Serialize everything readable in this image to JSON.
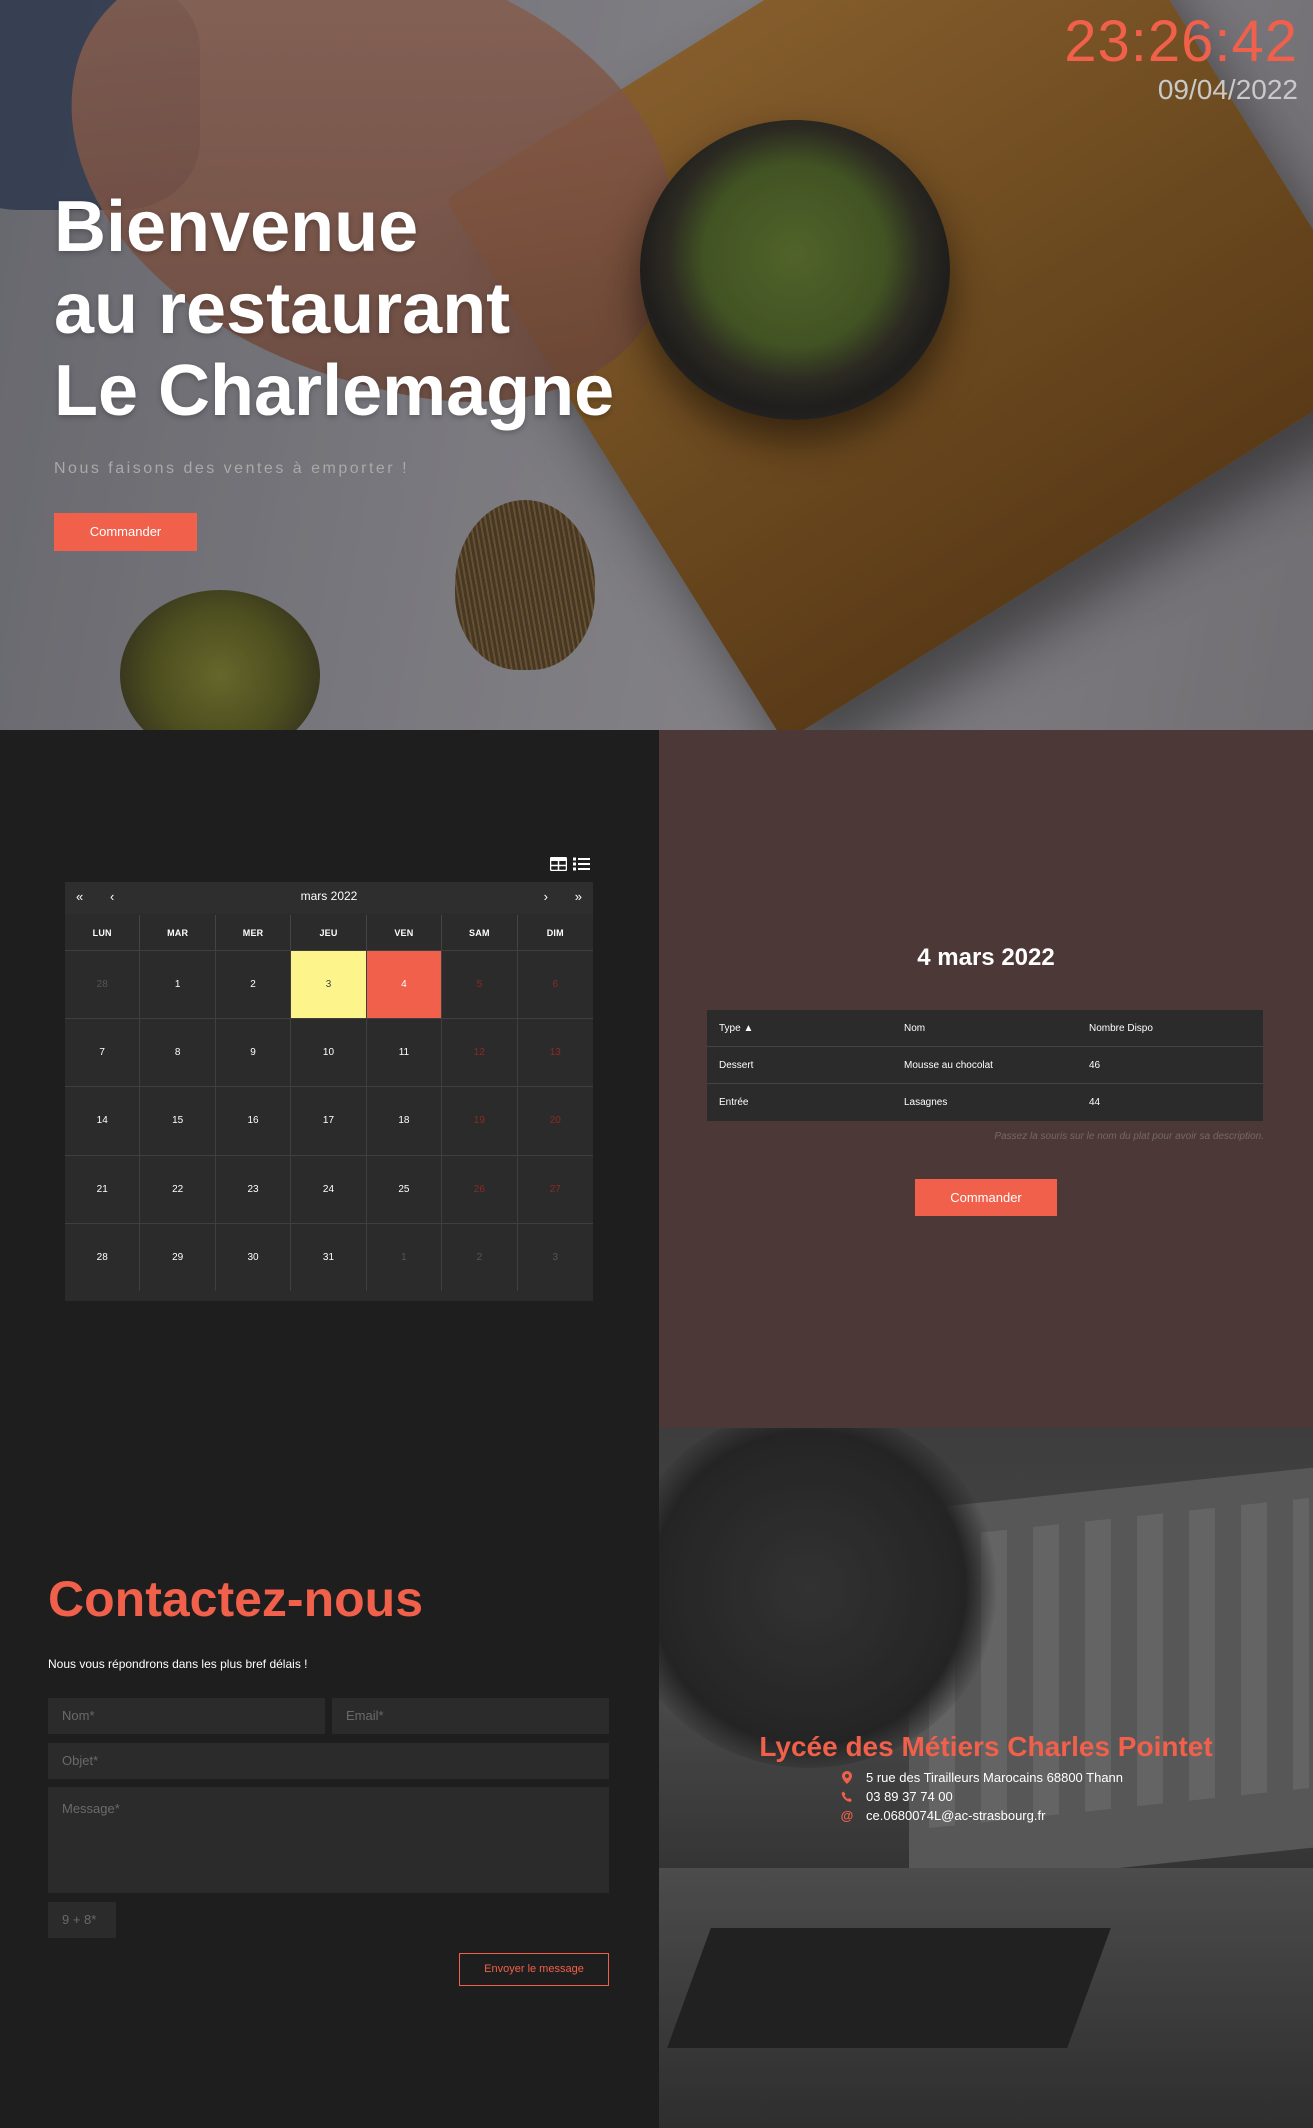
{
  "hero": {
    "clock_time": "23:26:42",
    "clock_date": "09/04/2022",
    "title_lines": [
      "Bienvenue",
      "au restaurant",
      "Le Charlemagne"
    ],
    "subtitle": "Nous faisons des ventes à emporter !",
    "button": "Commander"
  },
  "calendar": {
    "month": "mars 2022",
    "nav": {
      "first": "«",
      "prev": "‹",
      "next": "›",
      "last": "»"
    },
    "weekdays": [
      "LUN",
      "MAR",
      "MER",
      "JEU",
      "VEN",
      "SAM",
      "DIM"
    ],
    "weeks": [
      [
        "28",
        "1",
        "2",
        "3",
        "4",
        "5",
        "6"
      ],
      [
        "7",
        "8",
        "9",
        "10",
        "11",
        "12",
        "13"
      ],
      [
        "14",
        "15",
        "16",
        "17",
        "18",
        "19",
        "20"
      ],
      [
        "21",
        "22",
        "23",
        "24",
        "25",
        "26",
        "27"
      ],
      [
        "28",
        "29",
        "30",
        "31",
        "1",
        "2",
        "3"
      ]
    ],
    "today": "3",
    "selected": "4"
  },
  "menu": {
    "date_title": "4 mars 2022",
    "headers": [
      "Type ▲",
      "Nom",
      "Nombre Dispo"
    ],
    "rows": [
      [
        "Dessert",
        "Mousse au chocolat",
        "46"
      ],
      [
        "Entrée",
        "Lasagnes",
        "44"
      ]
    ],
    "hint": "Passez la souris sur le nom du plat pour avoir sa description.",
    "button": "Commander"
  },
  "contact": {
    "title": "Contactez-nous",
    "subtitle": "Nous vous répondrons dans les plus bref délais !",
    "name_placeholder": "Nom*",
    "email_placeholder": "Email*",
    "subject_placeholder": "Objet*",
    "message_placeholder": "Message*",
    "captcha": "9 + 8*",
    "send": "Envoyer le message"
  },
  "school": {
    "name": "Lycée des Métiers Charles Pointet",
    "address": "5 rue des Tirailleurs Marocains 68800 Thann",
    "phone": "03 89 37 74 00",
    "email": "ce.0680074L@ac-strasbourg.fr"
  },
  "colors": {
    "accent": "#f0604a",
    "dark": "#1e1e1f",
    "brown": "#4d3838",
    "today": "#fdf58b"
  }
}
